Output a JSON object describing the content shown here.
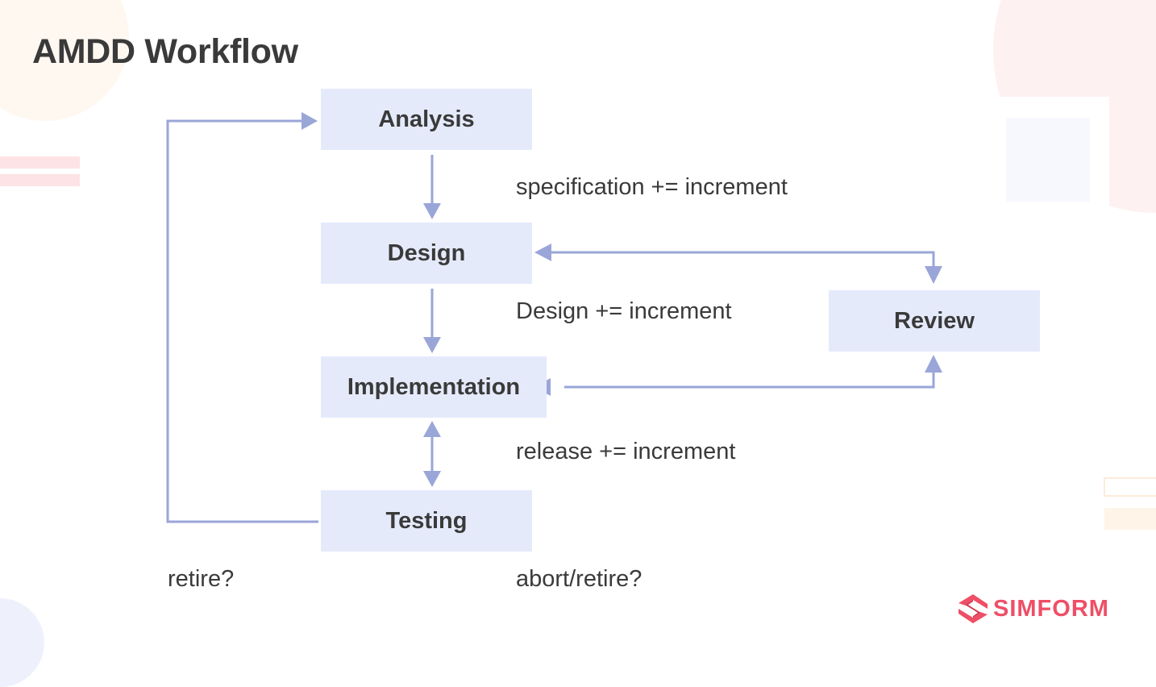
{
  "title": "AMDD Workflow",
  "nodes": {
    "analysis": "Analysis",
    "design": "Design",
    "implementation": "Implementation",
    "testing": "Testing",
    "review": "Review"
  },
  "edge_labels": {
    "analysis_to_design": "specification += increment",
    "design_to_implementation": "Design += increment",
    "implementation_to_testing": "release += increment",
    "testing_loop": "retire?",
    "testing_exit": "abort/retire?"
  },
  "logo": {
    "text": "SIMFORM",
    "icon": "simform-logo-icon"
  },
  "colors": {
    "node_fill": "#E5EAFB",
    "connector": "#9AA6D8",
    "text": "#3a3a3a",
    "brand": "#EE4F66"
  }
}
